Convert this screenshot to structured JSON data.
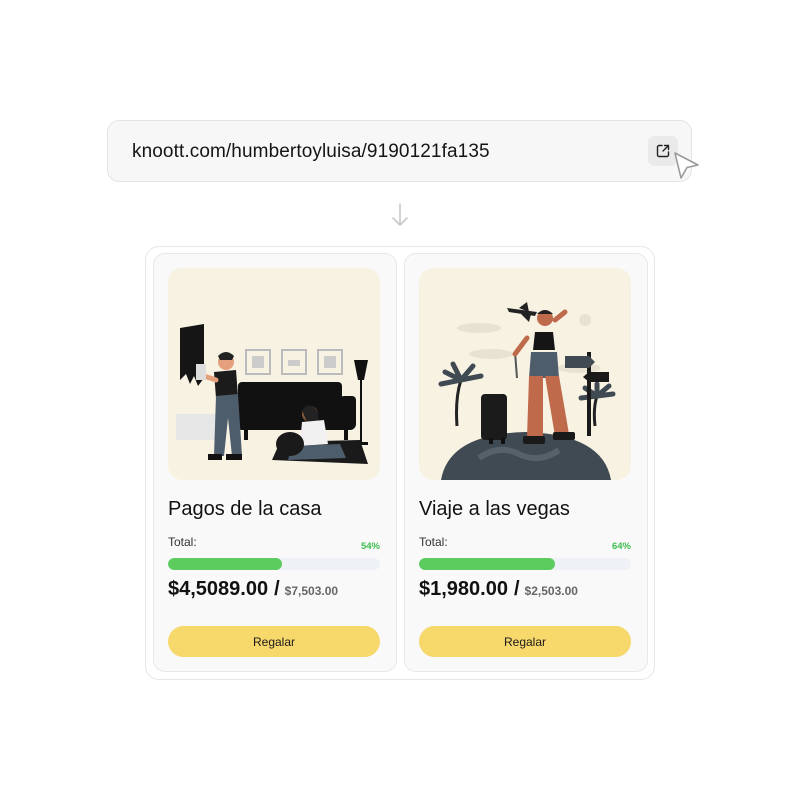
{
  "share": {
    "url": "knoott.com/humbertoyluisa/9190121fa135",
    "open_icon": "external-link-icon"
  },
  "colors": {
    "accent_button": "#f7d86b",
    "progress_fill": "#5ccc5f",
    "progress_track": "#eef1f5",
    "percent_text": "#3ebd4f"
  },
  "cards": [
    {
      "title": "Pagos de la casa",
      "total_label": "Total:",
      "percent_label": "54%",
      "progress": 0.54,
      "amount": "$4,5089.00",
      "separator": "/",
      "goal": "$7,503.00",
      "button_label": "Regalar"
    },
    {
      "title": "Viaje a las vegas",
      "total_label": "Total:",
      "percent_label": "64%",
      "progress": 0.64,
      "amount": "$1,980.00",
      "separator": "/",
      "goal": "$2,503.00",
      "button_label": "Regalar"
    }
  ]
}
